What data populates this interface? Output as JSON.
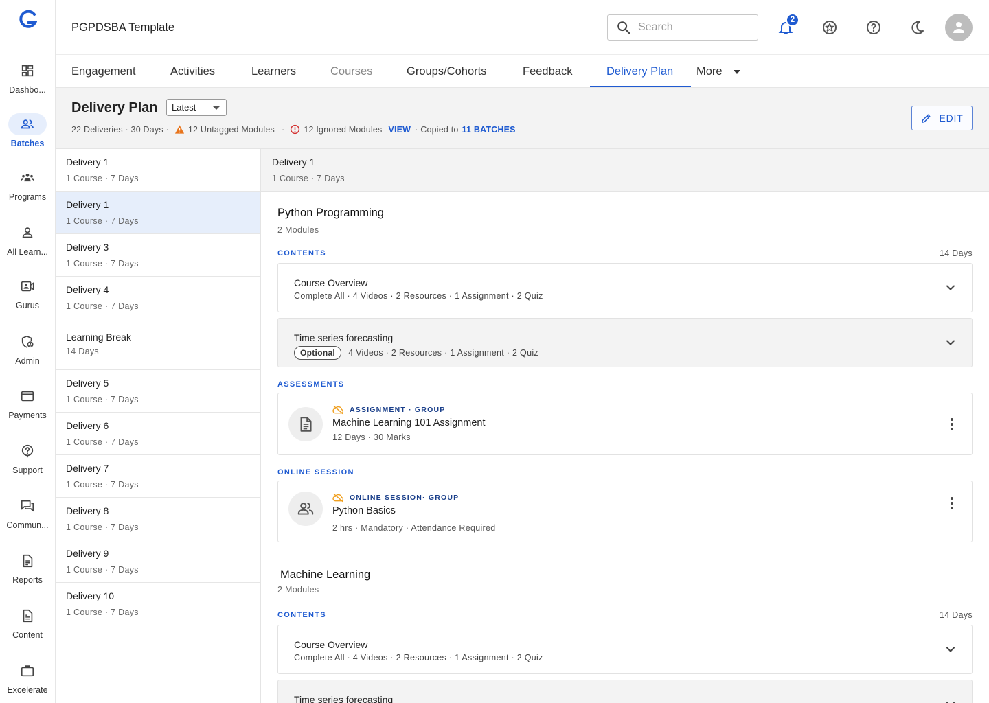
{
  "app": {
    "title": "PGPDSBA Template"
  },
  "rail": [
    {
      "key": "dashboard",
      "label": "Dashbo...",
      "icon": "dashboard-icon"
    },
    {
      "key": "batches",
      "label": "Batches",
      "icon": "batches-icon",
      "active": true
    },
    {
      "key": "programs",
      "label": "Programs",
      "icon": "programs-icon"
    },
    {
      "key": "all-learners",
      "label": "All Learn...",
      "icon": "person-icon"
    },
    {
      "key": "gurus",
      "label": "Gurus",
      "icon": "video-person-icon"
    },
    {
      "key": "admin",
      "label": "Admin",
      "icon": "admin-shield-icon"
    },
    {
      "key": "payments",
      "label": "Payments",
      "icon": "credit-card-icon"
    },
    {
      "key": "support",
      "label": "Support",
      "icon": "support-icon"
    },
    {
      "key": "community",
      "label": "Commun...",
      "icon": "chat-icon"
    },
    {
      "key": "reports",
      "label": "Reports",
      "icon": "report-icon"
    },
    {
      "key": "content",
      "label": "Content",
      "icon": "content-icon"
    },
    {
      "key": "excelerate",
      "label": "Excelerate",
      "icon": "briefcase-icon"
    }
  ],
  "topbar": {
    "search_placeholder": "Search",
    "notification_count": "2"
  },
  "tabs": [
    {
      "label": "Engagement"
    },
    {
      "label": "Activities"
    },
    {
      "label": "Learners"
    },
    {
      "label": "Courses",
      "muted": true
    },
    {
      "label": "Groups/Cohorts"
    },
    {
      "label": "Feedback"
    },
    {
      "label": "Delivery Plan",
      "active": true
    },
    {
      "label": "More"
    }
  ],
  "header": {
    "title": "Delivery Plan",
    "version": "Latest",
    "deliveries": "22 Deliveries · 30 Days ·",
    "untagged": "12 Untagged Modules",
    "sep": "·",
    "ignored": "12 Ignored Modules",
    "view_link": "VIEW",
    "copied_prefix": "· Copied to",
    "batches_link": "11 BATCHES",
    "edit_label": "EDIT",
    "colors": {
      "accent": "#1f5bd1",
      "warning": "#e8741b",
      "error": "#d32f2f"
    }
  },
  "deliveries": [
    {
      "name": "Delivery 1",
      "sub": "1 Course · 7 Days"
    },
    {
      "name": "Delivery 1",
      "sub": "1 Course · 7 Days",
      "selected": true
    },
    {
      "name": "Delivery 3",
      "sub": "1 Course · 7 Days"
    },
    {
      "name": "Delivery 4",
      "sub": "1 Course · 7 Days"
    },
    {
      "name": "Learning Break",
      "sub": "14 Days",
      "tall": true
    },
    {
      "name": "Delivery 5",
      "sub": "1 Course · 7 Days"
    },
    {
      "name": "Delivery 6",
      "sub": "1 Course · 7 Days"
    },
    {
      "name": "Delivery 7",
      "sub": "1 Course · 7 Days"
    },
    {
      "name": "Delivery 8",
      "sub": "1 Course · 7 Days"
    },
    {
      "name": "Delivery 9",
      "sub": "1 Course · 7 Days"
    },
    {
      "name": "Delivery 10",
      "sub": "1 Course · 7 Days"
    }
  ],
  "detail": {
    "title": "Delivery 1",
    "sub": "1 Course · 7 Days",
    "course1": {
      "title": "Python Programming",
      "sub": "2 Modules",
      "contents_label": "CONTENTS",
      "contents_days": "14 Days",
      "mod1_title": "Course Overview",
      "mod1_sub": "Complete All · 4 Videos  · 2 Resources · 1 Assignment · 2 Quiz",
      "mod2_title": "Time series forecasting",
      "mod2_chip": "Optional",
      "mod2_sub": "4 Videos  · 2 Resources · 1 Assignment · 2 Quiz",
      "assess_label": "ASSESSMENTS",
      "assess_tag": "ASSIGNMENT · GROUP",
      "assess_title": "Machine Learning 101 Assignment",
      "assess_sub": "12 Days · 30 Marks",
      "online_label": "ONLINE SESSION",
      "online_tag": "ONLINE SESSION· GROUP",
      "online_title": "Python Basics",
      "online_sub": "2 hrs · Mandatory · Attendance Required"
    },
    "course2": {
      "title": "Machine Learning",
      "sub": "2 Modules",
      "contents_label": "CONTENTS",
      "contents_days": "14 Days",
      "mod1_title": "Course Overview",
      "mod1_sub": "Complete All · 4 Videos  · 2 Resources · 1 Assignment · 2 Quiz",
      "mod2_title": "Time series forecasting"
    }
  }
}
